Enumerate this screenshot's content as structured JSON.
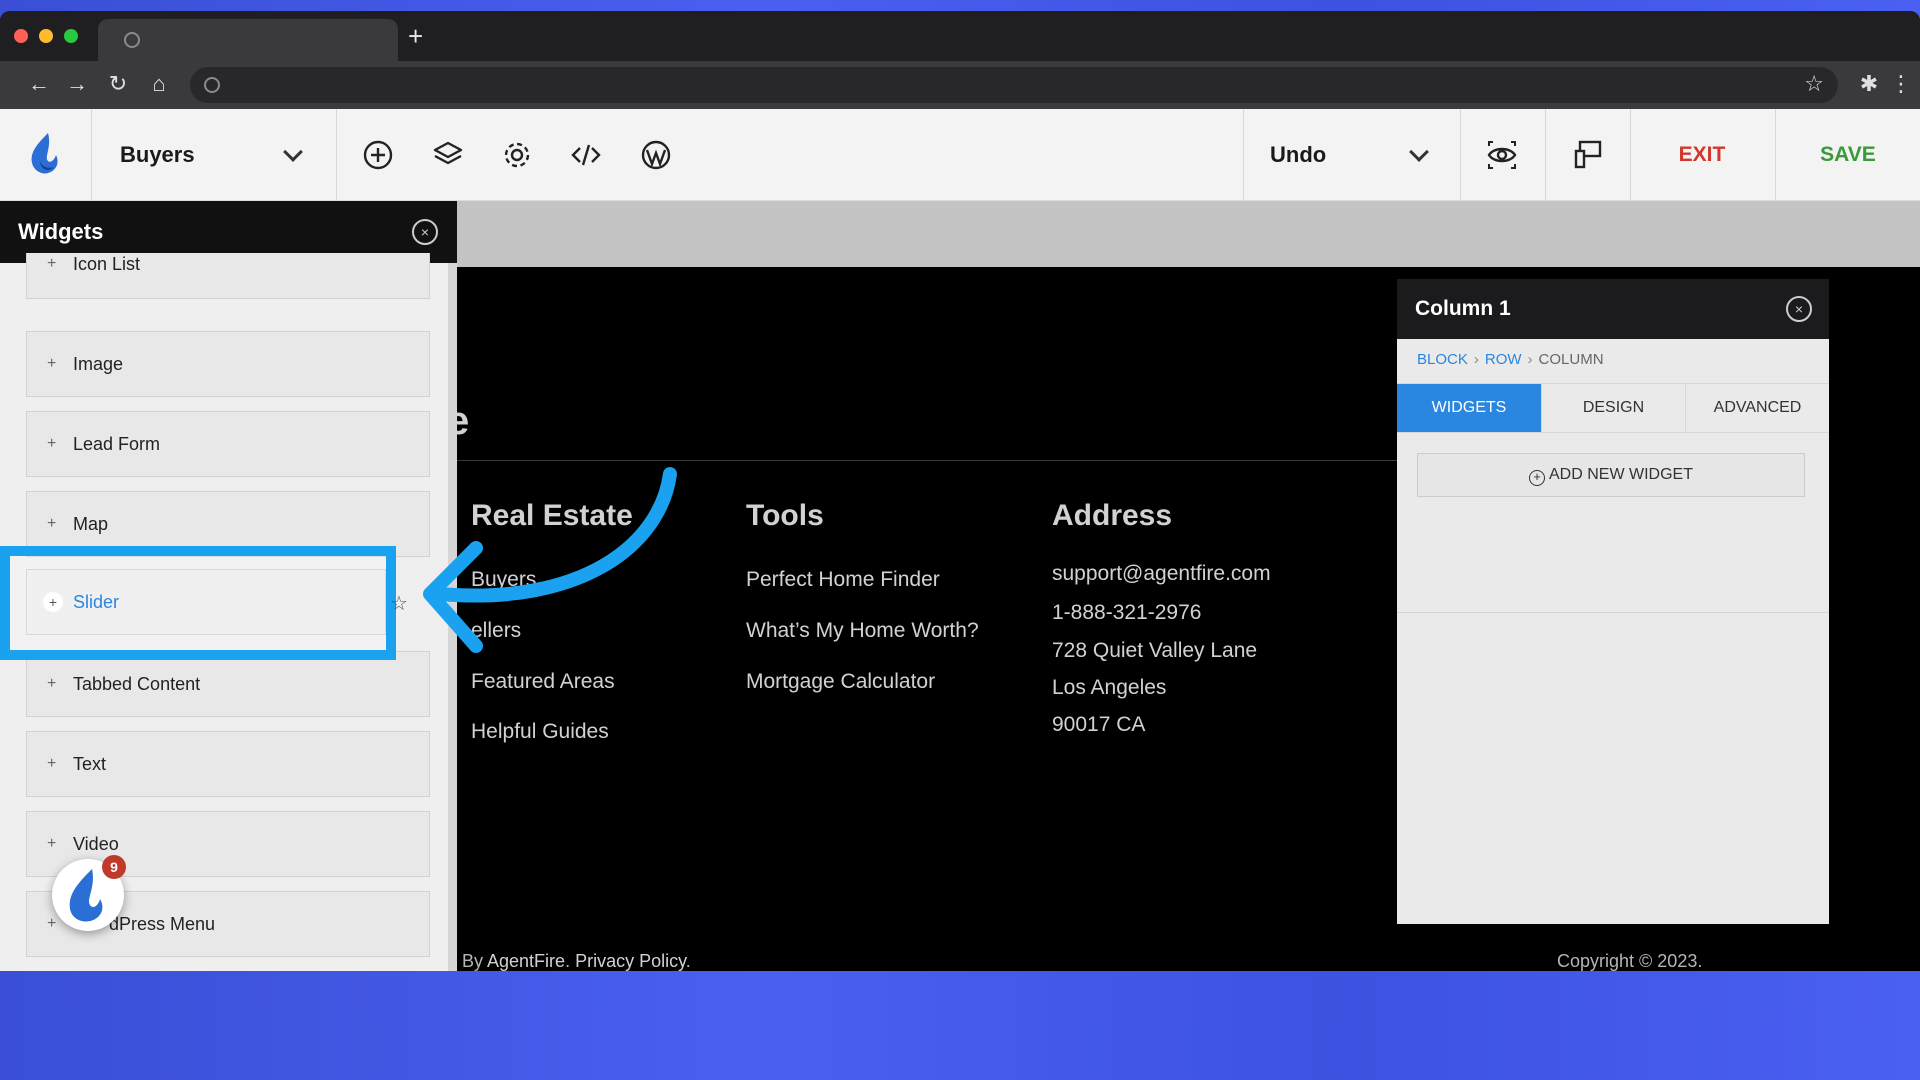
{
  "browser": {
    "new_tab_label": "+",
    "icons": [
      "globe-icon",
      "back-icon",
      "forward-icon",
      "reload-icon",
      "home-icon",
      "star-icon",
      "extensions-icon",
      "menu-icon"
    ]
  },
  "toolbar": {
    "page_select": "Buyers",
    "undo_label": "Undo",
    "exit_label": "EXIT",
    "save_label": "SAVE",
    "icons": [
      "add-icon",
      "layers-icon",
      "settings-icon",
      "code-icon",
      "wordpress-icon",
      "preview-icon",
      "responsive-icon"
    ]
  },
  "widgets_panel": {
    "title": "Widgets",
    "items": [
      {
        "label": "Icon List"
      },
      {
        "label": "Image"
      },
      {
        "label": "Lead Form"
      },
      {
        "label": "Map"
      },
      {
        "label": "Slider"
      },
      {
        "label": "Tabbed Content"
      },
      {
        "label": "Text"
      },
      {
        "label": "Video"
      },
      {
        "label": "dPress Menu"
      }
    ]
  },
  "canvas": {
    "partial_heading": "e",
    "columns": [
      {
        "title": "Real Estate",
        "links": [
          "Buyers",
          "ellers",
          "Featured Areas",
          "Helpful Guides"
        ]
      },
      {
        "title": "Tools",
        "links": [
          "Perfect Home Finder",
          "What’s My Home Worth?",
          "Mortgage Calculator"
        ]
      },
      {
        "title": "Address",
        "links": [
          "support@agentfire.com",
          "1-888-321-2976",
          "728 Quiet Valley Lane",
          "Los Angeles",
          "90017 CA"
        ]
      }
    ],
    "footer_left_prefix": "By ",
    "footer_left_link1": "AgentFire",
    "footer_left_mid": ". ",
    "footer_left_link2": "Privacy Policy",
    "footer_left_suffix": ".",
    "footer_right": "Copyright © 2023."
  },
  "column_panel": {
    "title": "Column 1",
    "breadcrumb": [
      "BLOCK",
      "ROW",
      "COLUMN"
    ],
    "tabs": [
      "WIDGETS",
      "DESIGN",
      "ADVANCED"
    ],
    "active_tab": "WIDGETS",
    "add_widget_label": "ADD NEW WIDGET"
  },
  "launcher": {
    "badge_count": "9"
  },
  "colors": {
    "accent_blue": "#2b86e0",
    "highlight": "#1aa2f0",
    "exit_red": "#d0392b",
    "save_green": "#3a9a3a",
    "background_gradient": "#4a5ff0"
  }
}
